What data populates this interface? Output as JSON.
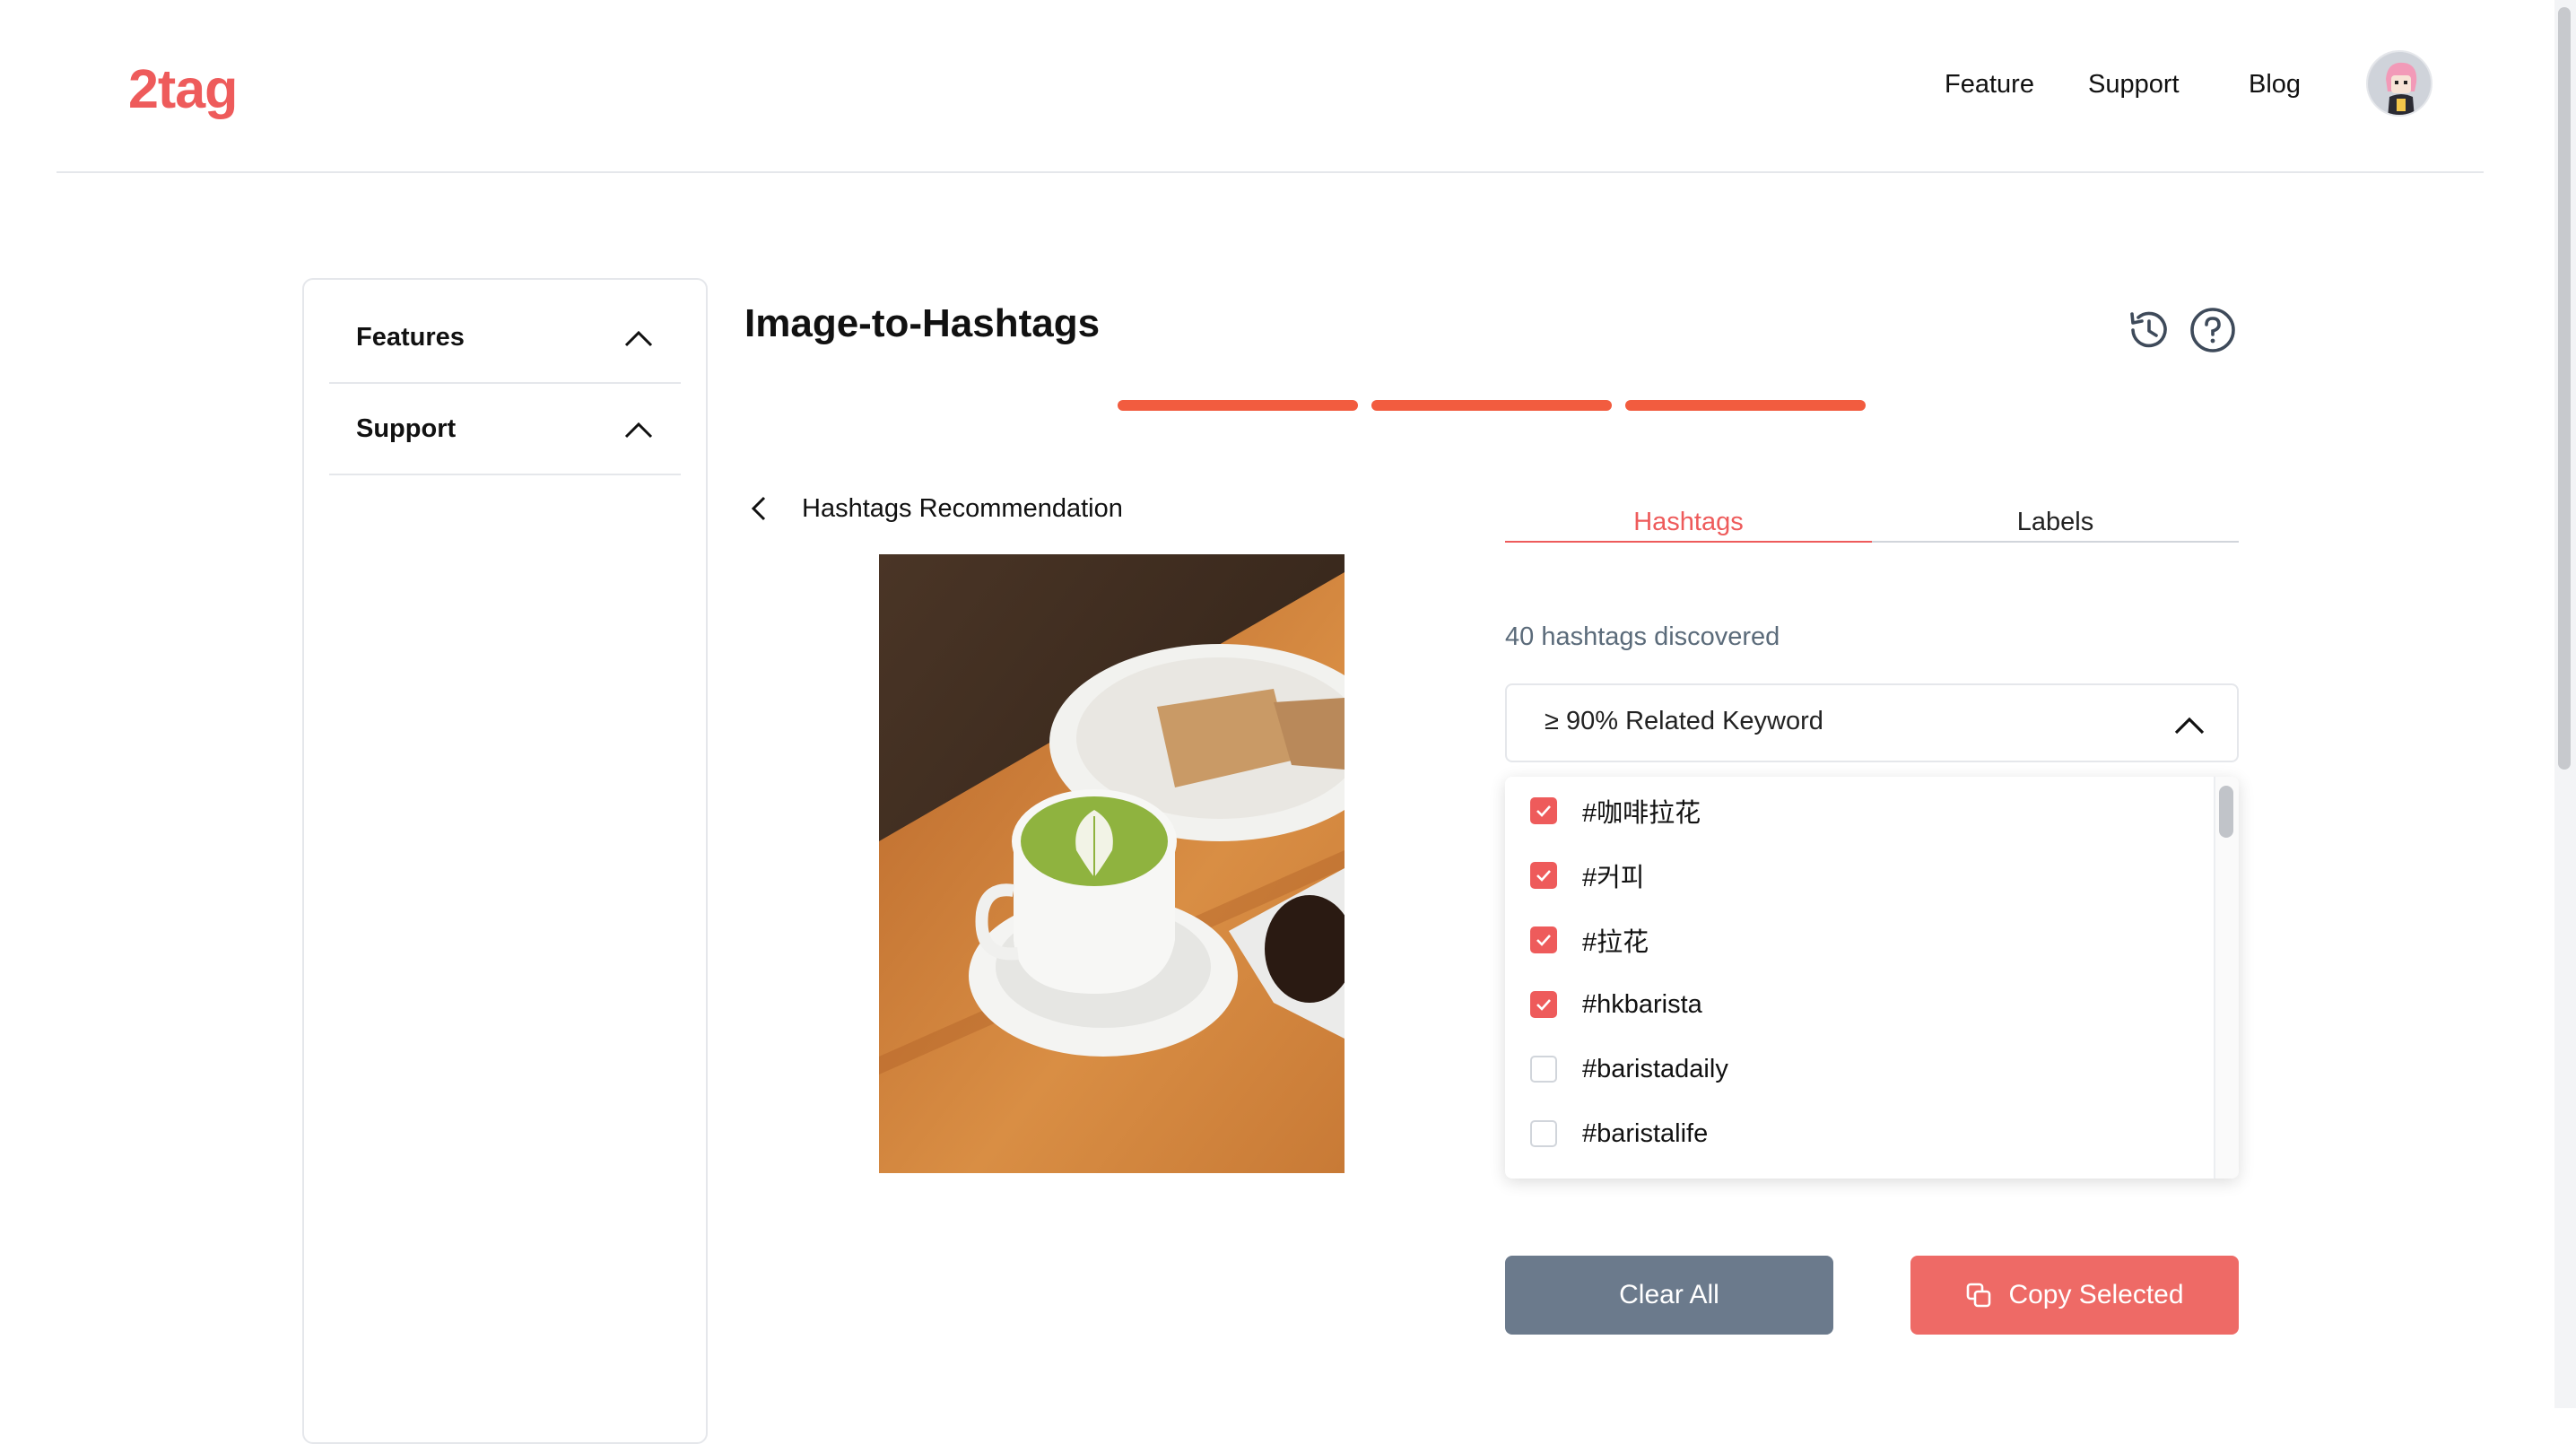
{
  "header": {
    "logo_text": "2tag",
    "nav": [
      "Feature",
      "Support",
      "Blog"
    ],
    "avatar_icon": "user-avatar"
  },
  "sidebar": {
    "items": [
      {
        "label": "Features",
        "icon": "chevron-up-icon"
      },
      {
        "label": "Support",
        "icon": "chevron-up-icon"
      }
    ]
  },
  "main": {
    "title": "Image-to-Hashtags",
    "icons": [
      "history-icon",
      "help-icon"
    ],
    "steps_completed": 3,
    "steps_total": 3,
    "back_label": "Hashtags Recommendation",
    "tabs": [
      {
        "label": "Hashtags",
        "active": true
      },
      {
        "label": "Labels",
        "active": false
      }
    ],
    "count_text": "40 hashtags discovered",
    "filter": {
      "selected": "≥ 90% Related Keyword"
    },
    "hashtags": [
      {
        "tag": "#咖啡拉花",
        "checked": true
      },
      {
        "tag": "#커피",
        "checked": true
      },
      {
        "tag": "#拉花",
        "checked": true
      },
      {
        "tag": "#hkbarista",
        "checked": true
      },
      {
        "tag": "#baristadaily",
        "checked": false
      },
      {
        "tag": "#baristalife",
        "checked": false
      }
    ],
    "buttons": {
      "clear": "Clear All",
      "copy": "Copy Selected"
    }
  },
  "colors": {
    "accent": "#ee5b5b",
    "progress": "#f25c3f",
    "clear_button": "#6b7a8c",
    "copy_button": "#ee6a66"
  }
}
